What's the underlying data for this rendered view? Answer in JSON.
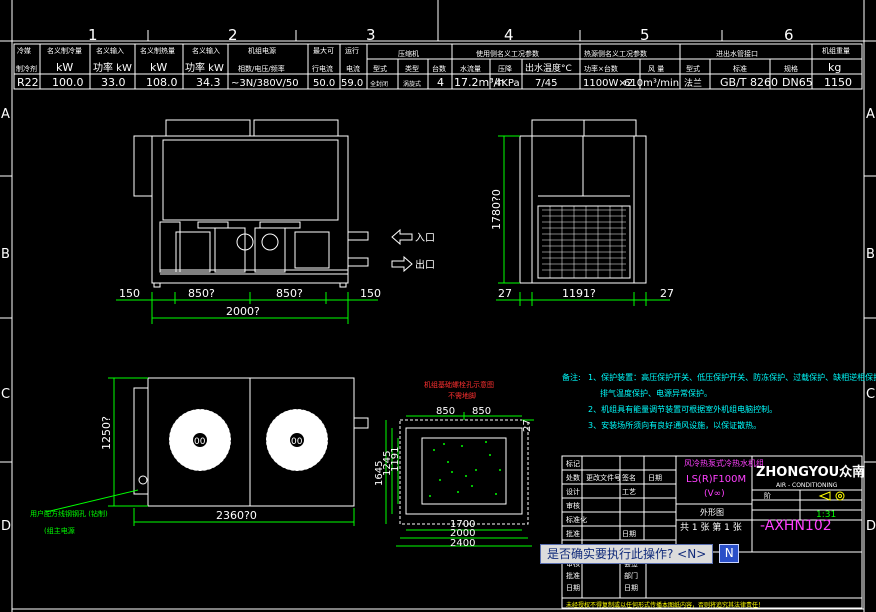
{
  "frame": {
    "top_numbers": [
      "1",
      "2",
      "3",
      "4",
      "5",
      "6"
    ],
    "side_letters": [
      "A",
      "B",
      "C",
      "D"
    ]
  },
  "spec_table": {
    "header_row1": [
      "冷媒",
      "名义制冷量",
      "名义输入",
      "名义制热量",
      "名义输入",
      "机组电源",
      "最大可",
      "运行",
      "压缩机",
      "使用侧名义工况参数",
      "热源侧名义工况参数",
      "进出水管接口",
      "机组重量"
    ],
    "header_row2": [
      "制冷剂",
      "kW",
      "功率 kW",
      "kW",
      "功率 kW",
      "相数/电压/频率",
      "行电流",
      "电流",
      "型式",
      "类型",
      "台数",
      "水流量",
      "压降",
      "出水温度°C",
      "功率×台数",
      "风 量",
      "型式",
      "标准",
      "规格",
      "kg"
    ],
    "values": [
      "R22",
      "100.0",
      "33.0",
      "108.0",
      "34.3",
      "~3N/380V/50",
      "50.0",
      "59.0",
      "全封闭",
      "涡旋式",
      "4",
      "17.2m³/h",
      "4KPa",
      "7/45",
      "1100W×2",
      "610m³/min",
      "法兰",
      "GB/T 8260",
      "DN65",
      "1150"
    ]
  },
  "dimensions": {
    "front_width_total": "2000?",
    "front_seg_left": "150",
    "front_seg_mid1": "850?",
    "front_seg_mid2": "850?",
    "front_seg_right": "150",
    "side_height": "1780?0",
    "side_seg_left": "27",
    "side_seg_mid": "1191?",
    "side_seg_right": "27",
    "top_width": "2360?0",
    "top_depth": "1250?",
    "base_850_left": "850",
    "base_850_right": "850",
    "base_27": "27",
    "base_1645": "1645",
    "base_1245": "1245",
    "base_1191": "1191",
    "base_1700": "1700",
    "base_2000": "2000",
    "base_2400": "2400"
  },
  "labels": {
    "inlet": "入口",
    "outlet": "出口",
    "fan_code": "00",
    "base_title": "机组基础螺栓孔示意图",
    "base_subtitle": "不需地脚",
    "user_note": "用户配方线钢钢孔 (钻制)",
    "user_note2": "(组主电源"
  },
  "notes": {
    "heading": "备注:",
    "line1": "1、保护装置：高压保护开关、低压保护开关、防冻保护、过载保护、缺相逆相保护装置、",
    "line1b": "排气温度保护、电源异常保护。",
    "line2": "2、机组具有能量调节装置可根据室外机组电脑控制。",
    "line3": "3、安装场所须向有良好通风设施，以保证散热。"
  },
  "title_block": {
    "product_name": "风冷热泵式冷热水机组",
    "model": "LS(R)F100M",
    "model_sub": "(V∞)",
    "drawing_type": "外形图",
    "brand": "ZHONGYOU众南",
    "brand_sub": "AIR - CONDITIONING",
    "scale": "1:31",
    "drawing_no": "-AXHN102",
    "sheet": "共  1  张  第  1  张",
    "rows": [
      "标记",
      "处数",
      "更改文件号",
      "签名",
      "日期",
      "设计",
      "审核",
      "工艺",
      "标准化",
      "批准",
      "日期"
    ],
    "col_small": [
      "阶",
      "段",
      "标",
      "记"
    ],
    "bottom_note": "未经授权不得复制或以任何形式传播本图纸内容，否则将追究其法律责任！",
    "bottom_rows": [
      "审核",
      "批准",
      "日期"
    ],
    "group_rows": [
      "会签",
      "部门",
      "日期"
    ]
  },
  "command_prompt": {
    "text": "是否确实要执行此操作? <N>",
    "value": "N"
  },
  "colors": {
    "background": "#000000",
    "white": "#ffffff",
    "green": "#00ff00",
    "cyan": "#00ffff",
    "red": "#ff3030",
    "yellow": "#ffff00",
    "magenta": "#ff40ff"
  }
}
